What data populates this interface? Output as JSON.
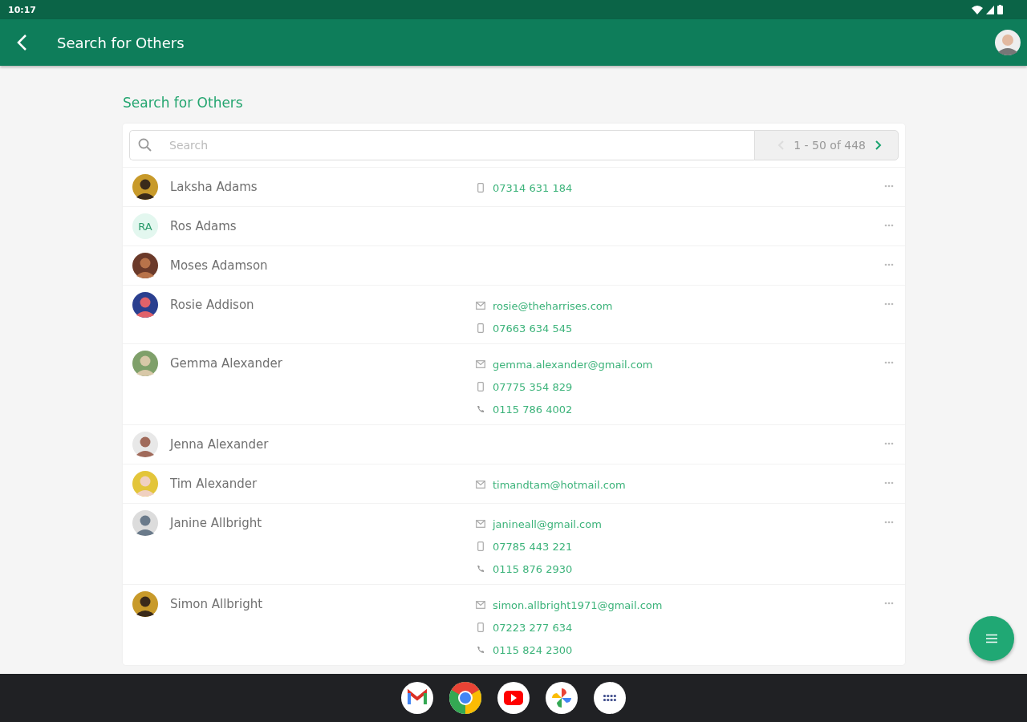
{
  "status_bar": {
    "time": "10:17"
  },
  "app_bar": {
    "title": "Search for Others",
    "account_avatar": {
      "kind": "picture"
    }
  },
  "heading": "Search for Others",
  "search": {
    "placeholder": "Search"
  },
  "pagination": {
    "label": "1 - 50 of 448",
    "prev_disabled": true,
    "next_disabled": false
  },
  "contacts": [
    {
      "name": "Laksha Adams",
      "avatar": {
        "kind": "picture"
      },
      "details": [
        {
          "kind": "mobile",
          "text": "07314 631 184"
        }
      ]
    },
    {
      "name": "Ros Adams",
      "avatar": {
        "kind": "initials",
        "text": "RA"
      }
    },
    {
      "name": "Moses Adamson",
      "avatar": {
        "kind": "picture"
      }
    },
    {
      "name": "Rosie Addison",
      "avatar": {
        "kind": "picture"
      },
      "details": [
        {
          "kind": "email",
          "text": "rosie@theharrises.com"
        },
        {
          "kind": "mobile",
          "text": "07663 634 545"
        }
      ]
    },
    {
      "name": "Gemma Alexander",
      "avatar": {
        "kind": "picture"
      },
      "details": [
        {
          "kind": "email",
          "text": "gemma.alexander@gmail.com"
        },
        {
          "kind": "mobile",
          "text": "07775 354 829"
        },
        {
          "kind": "phone",
          "text": "0115 786 4002"
        }
      ]
    },
    {
      "name": "Jenna Alexander",
      "avatar": {
        "kind": "picture"
      }
    },
    {
      "name": "Tim Alexander",
      "avatar": {
        "kind": "picture"
      },
      "details": [
        {
          "kind": "email",
          "text": "timandtam@hotmail.com"
        }
      ]
    },
    {
      "name": "Janine Allbright",
      "avatar": {
        "kind": "picture"
      },
      "details": [
        {
          "kind": "email",
          "text": "janineall@gmail.com"
        },
        {
          "kind": "mobile",
          "text": "07785 443 221"
        },
        {
          "kind": "phone",
          "text": "0115 876 2930"
        }
      ]
    },
    {
      "name": "Simon Allbright",
      "avatar": {
        "kind": "picture"
      },
      "details": [
        {
          "kind": "email",
          "text": "simon.allbright1971@gmail.com"
        },
        {
          "kind": "mobile",
          "text": "07223 277 634"
        },
        {
          "kind": "phone",
          "text": "0115 824 2300"
        }
      ]
    }
  ],
  "taskbar": [
    {
      "kind": "mail"
    },
    {
      "kind": "browser"
    },
    {
      "kind": "video"
    },
    {
      "kind": "photos"
    },
    {
      "kind": "apps"
    }
  ]
}
